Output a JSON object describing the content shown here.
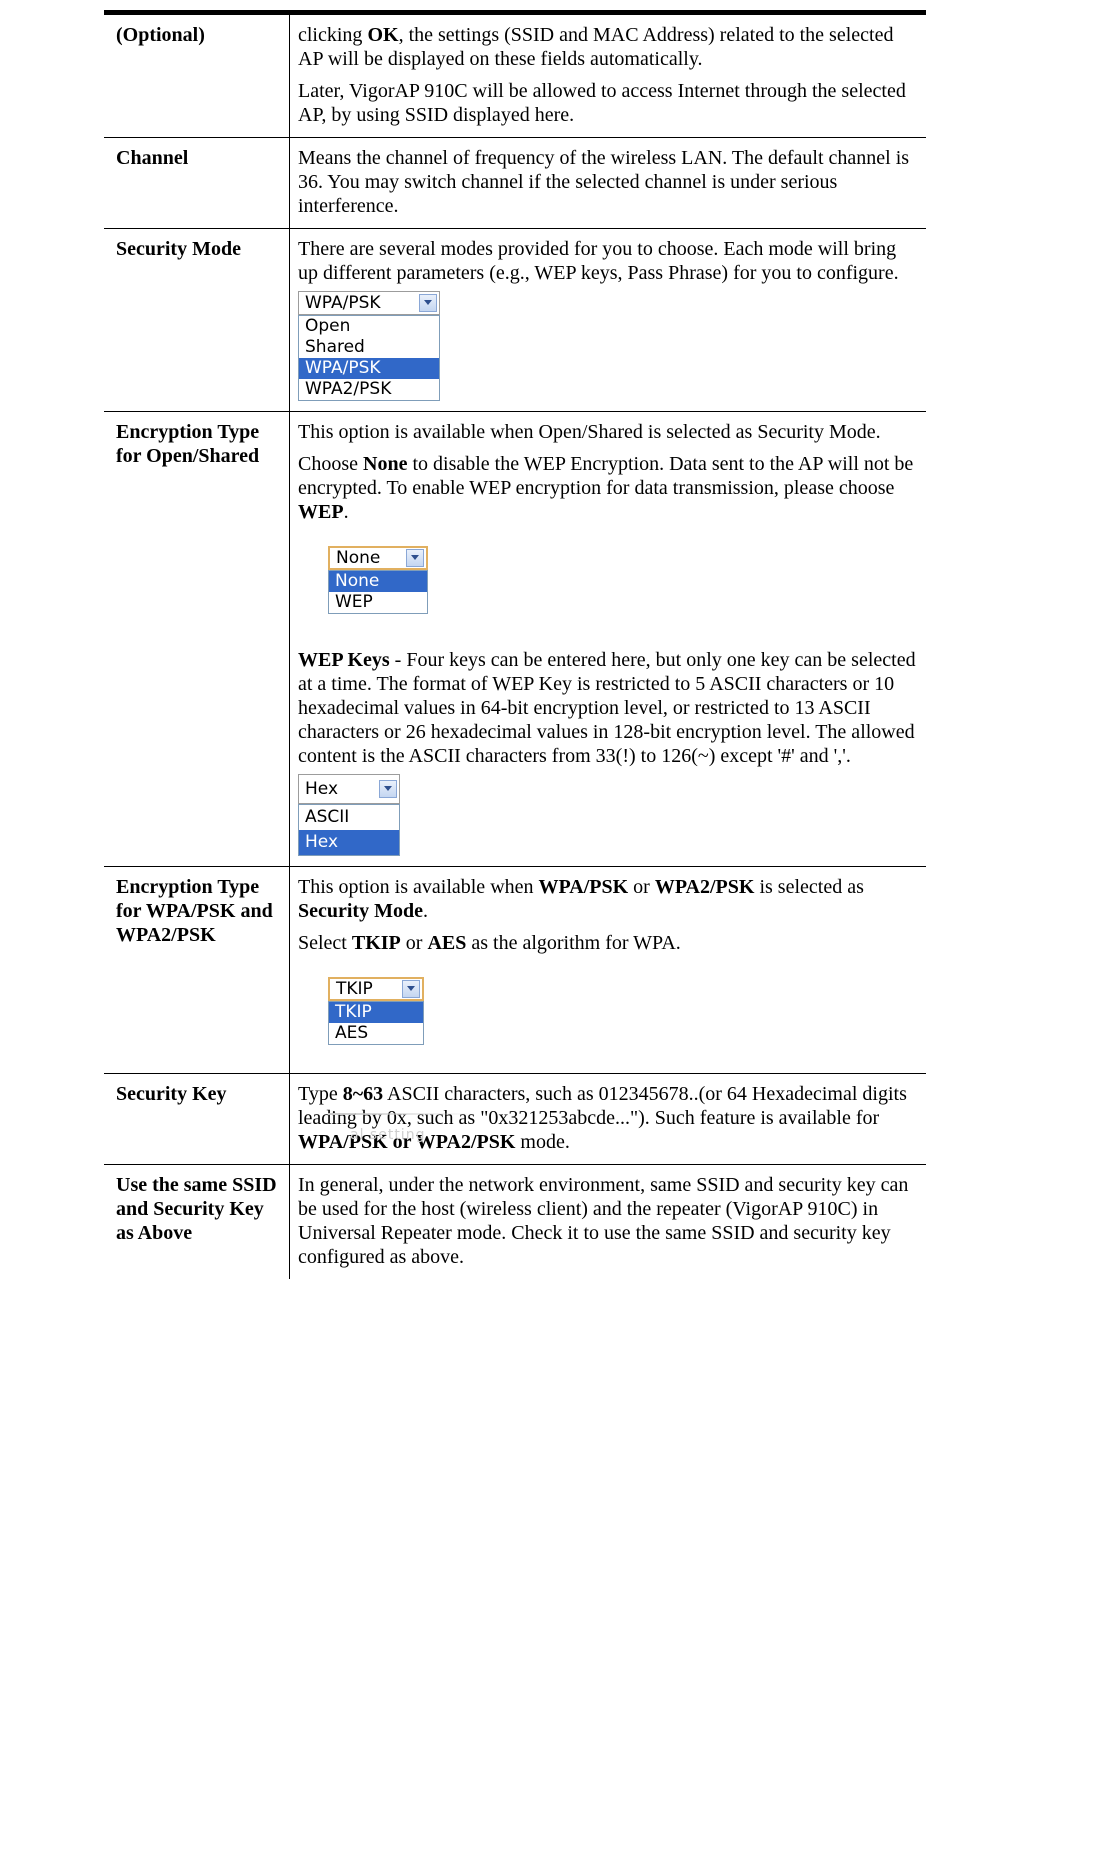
{
  "rows": {
    "optional": {
      "term": "(Optional)",
      "p1": [
        "clicking ",
        "OK",
        ", the settings (SSID and MAC Address) related to the selected AP will be displayed on these fields automatically."
      ],
      "p2": "Later, VigorAP 910C will be allowed to access Internet through the selected AP, by using SSID displayed here."
    },
    "channel": {
      "term": "Channel",
      "p1": "Means the channel of frequency of the wireless LAN. The default channel is 36. You may switch channel if the selected channel is under serious interference."
    },
    "security_mode": {
      "term": "Security Mode",
      "p1": "There are several modes provided for you to choose. Each mode will bring up different parameters (e.g., WEP keys, Pass Phrase) for you to configure.",
      "select": {
        "value": "WPA/PSK",
        "options": [
          "Open",
          "Shared",
          "WPA/PSK",
          "WPA2/PSK"
        ],
        "selected_index": 2
      }
    },
    "enc_open": {
      "term": "Encryption Type for Open/Shared",
      "p1": "This option is available when Open/Shared is selected as Security Mode.",
      "p2": [
        "Choose ",
        "None",
        " to disable the WEP Encryption. Data sent to the AP will not be encrypted. To enable WEP encryption for data transmission, please choose ",
        "WEP",
        "."
      ],
      "select": {
        "value": "None",
        "options": [
          "None",
          "WEP"
        ],
        "selected_index": 0
      },
      "p3": [
        "WEP Keys",
        " - Four keys can be entered here, but only one key can be selected at a time. The format of WEP Key is restricted to 5 ASCII characters or 10 hexadecimal values in 64-bit encryption level, or restricted to 13 ASCII characters or 26 hexadecimal values in 128-bit encryption level. The allowed content is the ASCII characters from 33(!) to 126(~) except '#' and ','."
      ],
      "select2": {
        "value": "Hex",
        "options": [
          "ASCII",
          "Hex"
        ],
        "selected_index": 1
      }
    },
    "enc_wpa": {
      "term": "Encryption Type for WPA/PSK and WPA2/PSK",
      "p1": [
        "This option is available when ",
        "WPA/PSK",
        " or ",
        "WPA2/PSK",
        " is selected as ",
        "Security Mode",
        "."
      ],
      "p2": [
        "Select ",
        "TKIP",
        " or ",
        "AES",
        " as the algorithm for WPA."
      ],
      "select": {
        "value": "TKIP",
        "options": [
          "TKIP",
          "AES"
        ],
        "selected_index": 0
      },
      "faded": "al setting"
    },
    "security_key": {
      "term": "Security Key",
      "p1": [
        "Type ",
        "8~63",
        " ASCII characters, such as 012345678..(or 64 Hexadecimal digits leading by 0x, such as \"0x321253abcde...\"). Such feature is available for ",
        "WPA/PSK or WPA2/PSK",
        " mode."
      ]
    },
    "same_ssid": {
      "term": "Use the same SSID and Security Key as Above",
      "p1": "In general, under the network environment, same SSID and security key can be used for the host (wireless client) and the repeater (VigorAP 910C) in Universal Repeater mode. Check it to use the same SSID and security key configured as above."
    }
  },
  "colors": {
    "highlight": "#3168c8",
    "focus_border": "#e1b060"
  }
}
